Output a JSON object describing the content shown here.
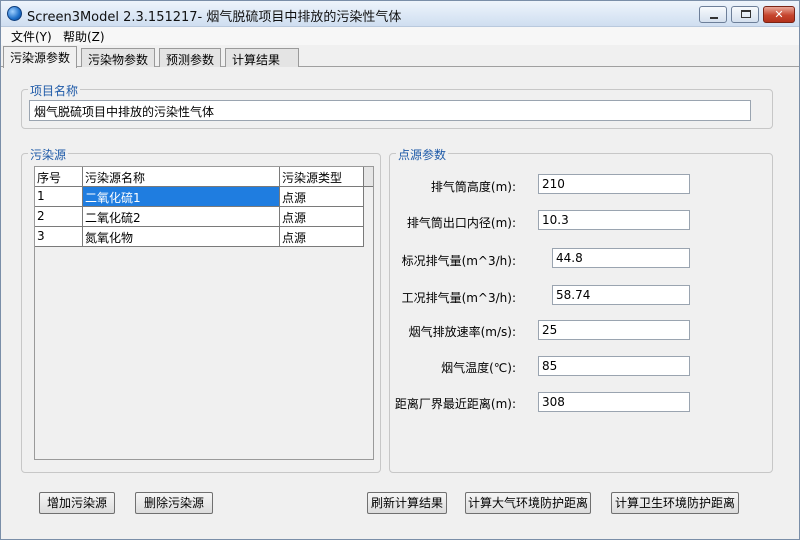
{
  "window": {
    "title": "Screen3Model 2.3.151217- 烟气脱硫项目中排放的污染性气体",
    "icon": "app-globe-icon"
  },
  "menu": {
    "file": "文件(Y)",
    "help": "帮助(Z)"
  },
  "tabs": [
    {
      "label": "污染源参数",
      "active": true
    },
    {
      "label": "污染物参数",
      "active": false
    },
    {
      "label": "预测参数",
      "active": false
    },
    {
      "label": "计算结果",
      "active": false
    }
  ],
  "project": {
    "group_title": "项目名称",
    "name_value": "烟气脱硫项目中排放的污染性气体"
  },
  "sources": {
    "group_title": "污染源",
    "columns": [
      "序号",
      "污染源名称",
      "污染源类型"
    ],
    "rows": [
      {
        "index": "1",
        "name": "二氧化硫1",
        "type": "点源",
        "selected": true
      },
      {
        "index": "2",
        "name": "二氧化硫2",
        "type": "点源",
        "selected": false
      },
      {
        "index": "3",
        "name": "氮氧化物",
        "type": "点源",
        "selected": false
      }
    ]
  },
  "point_source": {
    "group_title": "点源参数",
    "fields": [
      {
        "label": "排气筒高度(m):",
        "value": "210"
      },
      {
        "label": "排气筒出口内径(m):",
        "value": "10.3"
      },
      {
        "label": "标况排气量(m^3/h):",
        "value": "44.8"
      },
      {
        "label": "工况排气量(m^3/h):",
        "value": "58.74"
      },
      {
        "label": "烟气排放速率(m/s):",
        "value": "25"
      },
      {
        "label": "烟气温度(℃):",
        "value": "85"
      },
      {
        "label": "距离厂界最近距离(m):",
        "value": "308"
      }
    ]
  },
  "buttons": {
    "add": "增加污染源",
    "delete": "删除污染源",
    "refresh": "刷新计算结果",
    "atmos": "计算大气环境防护距离",
    "health": "计算卫生环境防护距离"
  },
  "colors": {
    "accent_title": "#1e5aa8",
    "selection": "#1f7de0"
  }
}
